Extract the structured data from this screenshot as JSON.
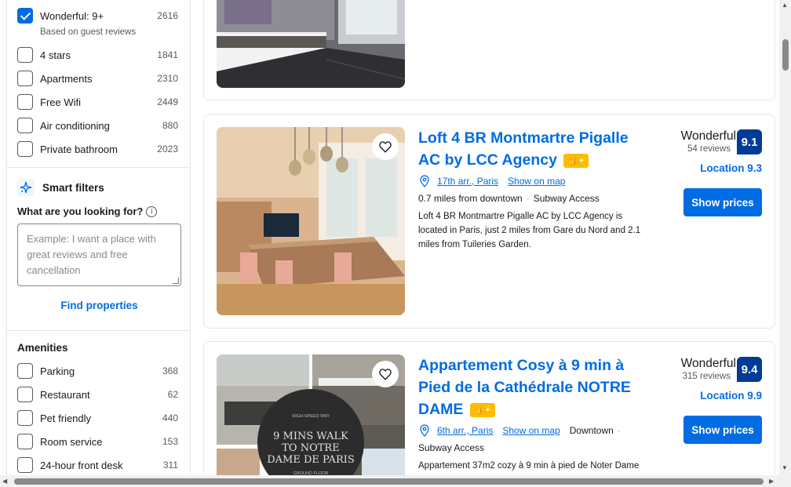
{
  "filters_top": [
    {
      "label": "Wonderful: 9+",
      "count": "2616",
      "checked": true,
      "sub": "Based on guest reviews"
    },
    {
      "label": "4 stars",
      "count": "1841",
      "checked": false
    },
    {
      "label": "Apartments",
      "count": "2310",
      "checked": false
    },
    {
      "label": "Free Wifi",
      "count": "2449",
      "checked": false
    },
    {
      "label": "Air conditioning",
      "count": "880",
      "checked": false
    },
    {
      "label": "Private bathroom",
      "count": "2023",
      "checked": false
    }
  ],
  "smart_filters": {
    "title": "Smart filters",
    "question": "What are you looking for?",
    "placeholder": "Example: I want a place with great reviews and free cancellation",
    "button": "Find properties"
  },
  "amenities": {
    "title": "Amenities",
    "items": [
      {
        "label": "Parking",
        "count": "368"
      },
      {
        "label": "Restaurant",
        "count": "62"
      },
      {
        "label": "Pet friendly",
        "count": "440"
      },
      {
        "label": "Room service",
        "count": "153"
      },
      {
        "label": "24-hour front desk",
        "count": "311"
      }
    ]
  },
  "listings": [
    {
      "name": "Loft 4 BR Montmartre Pigalle AC by LCC Agency",
      "area": "17th arr., Paris",
      "map_link": "Show on map",
      "distance": "0.7 miles from downtown",
      "tag": "Subway Access",
      "description": "Loft 4 BR Montmartre Pigalle AC by LCC Agency is located in Paris, just 2 miles from Gare du Nord and 2.1 miles from Tuileries Garden.",
      "rating_word": "Wonderful",
      "reviews": "54 reviews",
      "score": "9.1",
      "location_score": "Location 9.3",
      "cta": "Show prices"
    },
    {
      "name": "Appartement Cosy à 9 min à Pied de la Cathédrale NOTRE DAME",
      "area": "6th arr., Paris",
      "map_link": "Show on map",
      "distance": "Downtown",
      "tag": "Subway Access",
      "description": "Appartement 37m2 cozy à 9 min à pied de Noter Dame",
      "rating_word": "Wonderful",
      "reviews": "315 reviews",
      "score": "9.4",
      "location_score": "Location 9.9",
      "cta": "Show prices",
      "photo_text": [
        "HIGH-SPEED WIFI",
        "9 MINS WALK",
        "TO NOTRE",
        "DAME DE PARIS",
        "GROUND FLOOR"
      ]
    }
  ],
  "colors": {
    "accent": "#006ce4",
    "score_bg": "#003b95",
    "genius": "#febb02"
  },
  "icons": {
    "heart": "heart-icon",
    "pin": "map-pin-icon",
    "sparkle": "sparkle-icon",
    "info": "info-icon",
    "genius": "thumbs-up-plus-icon"
  }
}
